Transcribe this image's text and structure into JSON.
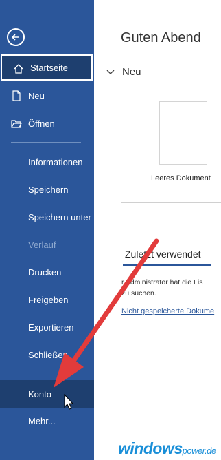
{
  "sidebar": {
    "back_icon": "arrow-left-circle-icon",
    "items": [
      {
        "label": "Startseite",
        "icon": "home-icon",
        "state": "active"
      },
      {
        "label": "Neu",
        "icon": "new-document-icon"
      },
      {
        "label": "Öffnen",
        "icon": "open-folder-icon"
      },
      {
        "label": "Informationen"
      },
      {
        "label": "Speichern"
      },
      {
        "label": "Speichern unter"
      },
      {
        "label": "Verlauf",
        "state": "disabled"
      },
      {
        "label": "Drucken"
      },
      {
        "label": "Freigeben"
      },
      {
        "label": "Exportieren"
      },
      {
        "label": "Schließen"
      },
      {
        "label": "Konto",
        "state": "hover"
      },
      {
        "label": "Mehr..."
      }
    ]
  },
  "main": {
    "greeting": "Guten Abend",
    "new_section": "Neu",
    "blank_document_label": "Leeres Dokument",
    "recent_tab": "Zuletzt verwendet",
    "admin_text_line1": "r Administrator hat die Lis",
    "admin_text_line2": "zu suchen.",
    "unsaved_link": "Nicht gespeicherte Dokume"
  },
  "watermark": {
    "brand": "windows",
    "suffix": "power",
    "tld": ".de"
  },
  "colors": {
    "sidebar_bg": "#2b569a",
    "active_bg": "#1e3f6f",
    "arrow": "#e23b3b",
    "link": "#2b579a"
  }
}
